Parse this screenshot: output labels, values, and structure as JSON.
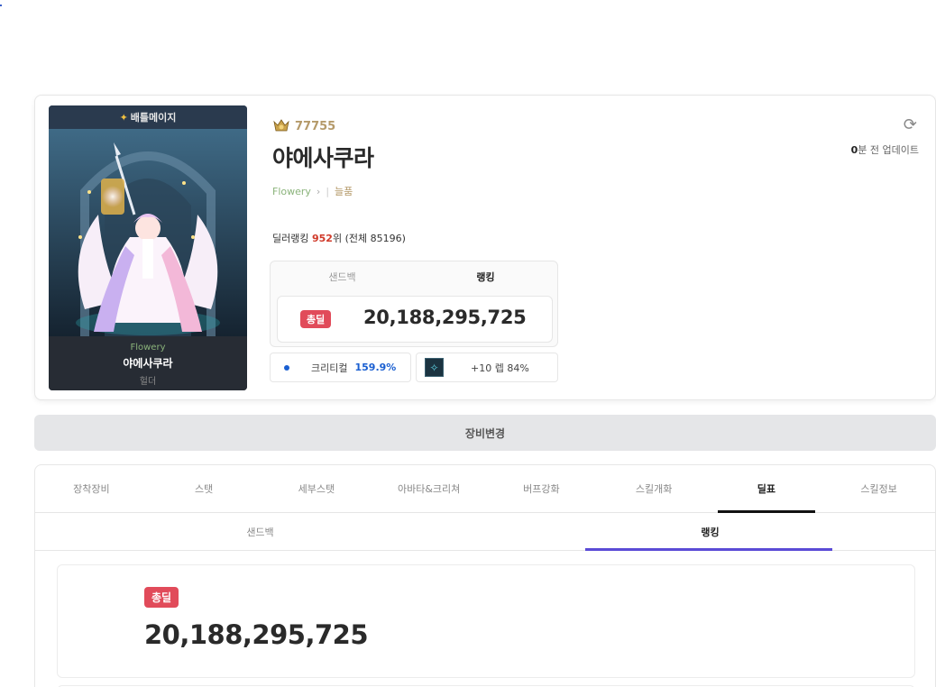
{
  "frame": {
    "header_icon": "badge-icon",
    "header_label": "배틀메이지",
    "server": "Flowery",
    "name": "야에사쿠라",
    "job": "헐더"
  },
  "profile": {
    "fame": "77755",
    "name": "야에사쿠라",
    "server": "Flowery",
    "guild": "늘품",
    "rank_prefix": "딜러랭킹 ",
    "rank_number": "952",
    "rank_suffix": "위 (전체 85196)",
    "updated_number": "0",
    "updated_text": "분 전 업데이트"
  },
  "mini_tabs": [
    "샌드백",
    "랭킹"
  ],
  "mini_total": {
    "badge": "총딜",
    "value": "20,188,295,725"
  },
  "chips": {
    "crit_label": "크리티컬",
    "crit_value": "159.9%",
    "item_text": "+10 렙 84%"
  },
  "equip_button": "장비변경",
  "main_tabs": [
    "장착장비",
    "스탯",
    "세부스탯",
    "아바타&크리쳐",
    "버프강화",
    "스킬개화",
    "딜표",
    "스킬정보"
  ],
  "sub_tabs": [
    "샌드백",
    "랭킹"
  ],
  "deal": {
    "badge": "총딜",
    "value": "20,188,295,725"
  },
  "colors": {
    "accent_red": "#e14b5a",
    "accent_purple": "#5b4bd6",
    "crit_blue": "#1a5fd1",
    "server_green": "#8ab37a",
    "fame_gold": "#b59a6a"
  }
}
